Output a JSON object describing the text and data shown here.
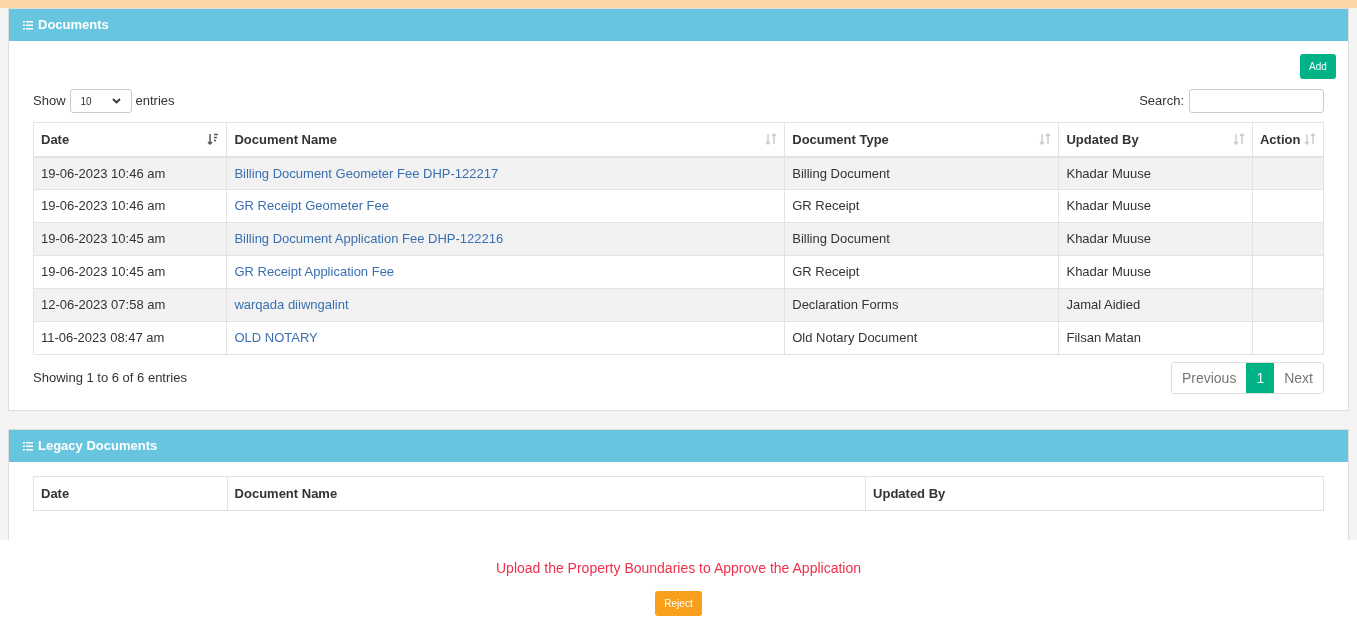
{
  "documents": {
    "title": "Documents",
    "add_button": "Add",
    "show_label": "Show",
    "page_size": "10",
    "entries_label": "entries",
    "search_label": "Search:",
    "columns": [
      {
        "label": "Date",
        "sorted": true
      },
      {
        "label": "Document Name",
        "sorted": false
      },
      {
        "label": "Document Type",
        "sorted": false
      },
      {
        "label": "Updated By",
        "sorted": false
      },
      {
        "label": "Action",
        "sorted": false
      }
    ],
    "rows": [
      {
        "date": "19-06-2023 10:46 am",
        "name": "Billing Document Geometer Fee DHP-122217",
        "type": "Billing Document",
        "updated_by": "Khadar Muuse"
      },
      {
        "date": "19-06-2023 10:46 am",
        "name": "GR Receipt Geometer Fee",
        "type": "GR Receipt",
        "updated_by": "Khadar Muuse"
      },
      {
        "date": "19-06-2023 10:45 am",
        "name": "Billing Document Application Fee DHP-122216",
        "type": "Billing Document",
        "updated_by": "Khadar Muuse"
      },
      {
        "date": "19-06-2023 10:45 am",
        "name": "GR Receipt Application Fee",
        "type": "GR Receipt",
        "updated_by": "Khadar Muuse"
      },
      {
        "date": "12-06-2023 07:58 am",
        "name": "warqada diiwngalint",
        "type": "Declaration Forms",
        "updated_by": "Jamal Aidied"
      },
      {
        "date": "11-06-2023 08:47 am",
        "name": "OLD NOTARY",
        "type": "Old Notary Document",
        "updated_by": "Filsan Matan"
      }
    ],
    "info": "Showing 1 to 6 of 6 entries",
    "pagination": [
      {
        "label": "Previous",
        "selected": false
      },
      {
        "label": "1",
        "selected": true
      },
      {
        "label": "Next",
        "selected": false
      }
    ]
  },
  "legacy_documents": {
    "title": "Legacy Documents",
    "columns": [
      "Date",
      "Document Name",
      "Updated By"
    ]
  },
  "warning": "Upload the Property Boundaries to Approve the Application",
  "reject_button": "Reject"
}
